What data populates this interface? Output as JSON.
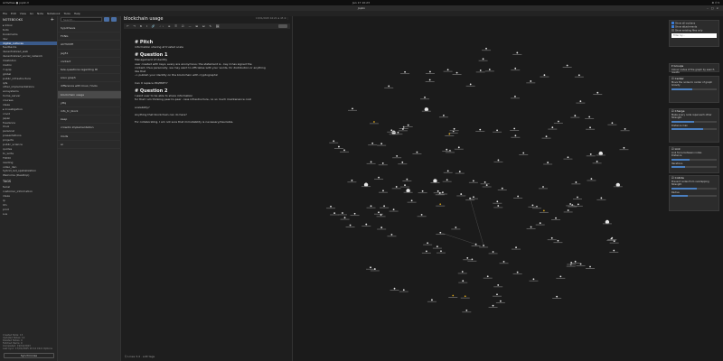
{
  "system": {
    "left": "Activities   ● joplin ▾",
    "clock": "Jan 17  10:23",
    "tray": "⚙ ⏻ ▾"
  },
  "window": {
    "title": "Joplin",
    "controls": "– □ ×"
  },
  "menu": [
    "File",
    "Edit",
    "View",
    "Go",
    "Note",
    "Notebook",
    "Tools",
    "Help"
  ],
  "sidebar": {
    "notebooks_label": "NOTEBOOKS",
    "items": [
      "▸ Inbox",
      "  todo",
      "  bookmarks",
      "  dev",
      "  digital_cultures",
      "     feedbacks",
      "     decentralized_web",
      "     decentralized_social_network",
      "        mastodon",
      "        matrix",
      "     7-ip/ip",
      "     global",
      "     public_infrastructure",
      "     ipfs",
      "     other_implementations",
      "  ecosystems",
      "home_server",
      "courses",
      "ideas",
      "▸ investigation",
      "  covid",
      "japan",
      "freelance",
      "linux",
      "personal",
      "presentations",
      "projects",
      "public_science",
      "quotes",
      "to_write",
      "TODO",
      "reading",
      "video_den",
      "   hybrid_led_spatialization",
      "   Welcome (Desktop)"
    ],
    "tags_label": "TAGS",
    "tags": [
      "facial",
      "customer_information",
      "ideas",
      "ip",
      "llm",
      "prod",
      "sus"
    ],
    "footer": [
      "Created Note: 13",
      "Updated Notes: 12",
      "Deleted Notes: 0",
      "Fetched Items: 0",
      "Completed: 19/19/2023",
      "Last sync: 17/01/2025 10:12 Click Options"
    ],
    "sync_label": "Synchronise"
  },
  "notelist": {
    "search_placeholder": "Search...",
    "notes": [
      "hypothesis",
      "FCNG",
      "ACTIVATE",
      "jeg51",
      "contact",
      "tele-questions regarding ID",
      "sous graph",
      "difference with linux / tools",
      "blockchain usage",
      "yttq",
      "info_tc_block",
      "keep",
      "crowdin implementation",
      "mods",
      "ai"
    ]
  },
  "editor": {
    "title": "blockchain usage",
    "meta": "13/01/2025 16:22   ⊕ 45  ⚙  ⋮",
    "toolbar": "↶ ↷  B I  🔗 ‹› ≡ ☰ ☑ — ⊞ ⊟  ✎ 🖼",
    "toggle_label": "",
    "footer": "⎘  Lines 3-4 · edit tags",
    "h1_pitch": "# Pitch",
    "pitch": "information sharing at trusted scale",
    "h1_q1": "# Question 1",
    "q1_lines": [
      "Management of identity",
      "user created with keys; every are anonymous; the statement is - key A has signed the",
      "content, thus personally, we may want to officialise with your words, for distribution or anything",
      "like that",
      "-> publish your identity on the blockchain with cryptographic",
      "",
      "Can it replace PKI/PKEY?"
    ],
    "h1_q2": "# Question 2",
    "q2_lines": [
      "I want user to be able to share information",
      "for that I am thinking peer-to-peer - less infrastructure, no so much maintenance cost",
      "",
      "scalability?",
      "",
      "Anything that blockchain can do here?",
      "",
      "For collaborating, I am not sure that immutability is necessary/desirable."
    ]
  },
  "graph_panel": {
    "filters": {
      "orphans": "Show all orphans",
      "attachments": "Show attachments",
      "existing": "Show existing files only",
      "search_placeholder": "Filter by..."
    },
    "groups": {
      "head": "▾ Groups",
      "desc": "Colour nodes of the graph by search results"
    },
    "center": {
      "head": "☑ Center",
      "desc": "Move the nodes to center of graph",
      "label1": "Gravity",
      "val1": 0.45
    },
    "charge": {
      "head": "☑ Charge",
      "desc": "Make every node repel each other",
      "label1": "Strength",
      "val1": 0.5,
      "label2": "Distance max",
      "val2": 0.7
    },
    "link": {
      "head": "☑ Link",
      "desc": "Link force between nodes",
      "label1": "Distance",
      "val1": 0.4,
      "label2": "Iterations",
      "val2": 0.3
    },
    "collide": {
      "head": "☑ Collide",
      "desc": "Prevent nodes from overlapping",
      "label1": "Strength",
      "val1": 0.55,
      "label2": "Radius",
      "val2": 0.35
    }
  },
  "colors": {
    "accent": "#4a7fc0",
    "selected_notebook": "#3a5a8a",
    "node": "#e8e8e8",
    "node_hot": "#d4a017"
  }
}
